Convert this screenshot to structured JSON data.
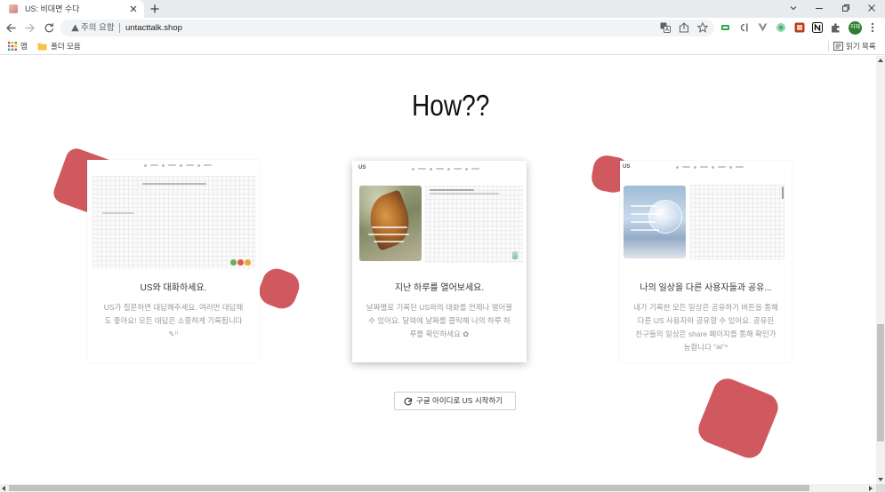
{
  "browser": {
    "tab": {
      "title": "US: 비대면 수다"
    },
    "address": {
      "security_label": "주의 요함",
      "url": "untacttalk.shop"
    },
    "profile": {
      "initials": "지혜"
    },
    "bookmarks": {
      "apps_label": "앱",
      "folder_label": "폴더 모음",
      "reading_list_label": "읽기 목록"
    }
  },
  "page": {
    "title": "How??",
    "cards": [
      {
        "heading": "US와 대화하세요.",
        "body": "US가 질문하면 대답해주세요. 여러번 대답해도 좋아요! 모든 대답은 소중하게 기록됩니다 ✎⁾⁾"
      },
      {
        "preview_logo": "US",
        "heading": "지난 하루를 열어보세요.",
        "body": "날짜별로 기록된 US와의 대화를 언제나 열어볼 수 있어요. 달력에 날짜를 클릭해 나의 하루 하루를 확인하세요 ✿"
      },
      {
        "preview_logo": "US",
        "heading": "나의 일상을 다른 사용자들과 공유...",
        "body": "내가 기록한 모든 일상은 공유하기 버튼을 통해 다른 US 사용자와 공유할 수 있어요. 공유된 친구들의 일상은 share 페이지를 통해 확인가능합니다 ˚✉˚*"
      }
    ],
    "cta": {
      "label": "구글 아이디로 US 시작하기"
    }
  },
  "colors": {
    "accent": "#d0595f",
    "profile": "#2e7d32",
    "heading_text": "#333333",
    "body_text": "#9a9a9a"
  },
  "icons": [
    "favicon-icon",
    "close-tab-icon",
    "new-tab-icon",
    "tab-search-icon",
    "minimize-icon",
    "restore-icon",
    "close-window-icon",
    "back-icon",
    "forward-icon",
    "reload-icon",
    "warning-icon",
    "translate-icon",
    "share-icon",
    "star-icon",
    "extension-icon",
    "puzzle-icon",
    "menu-icon",
    "apps-icon",
    "folder-icon",
    "reading-list-icon",
    "google-icon"
  ]
}
